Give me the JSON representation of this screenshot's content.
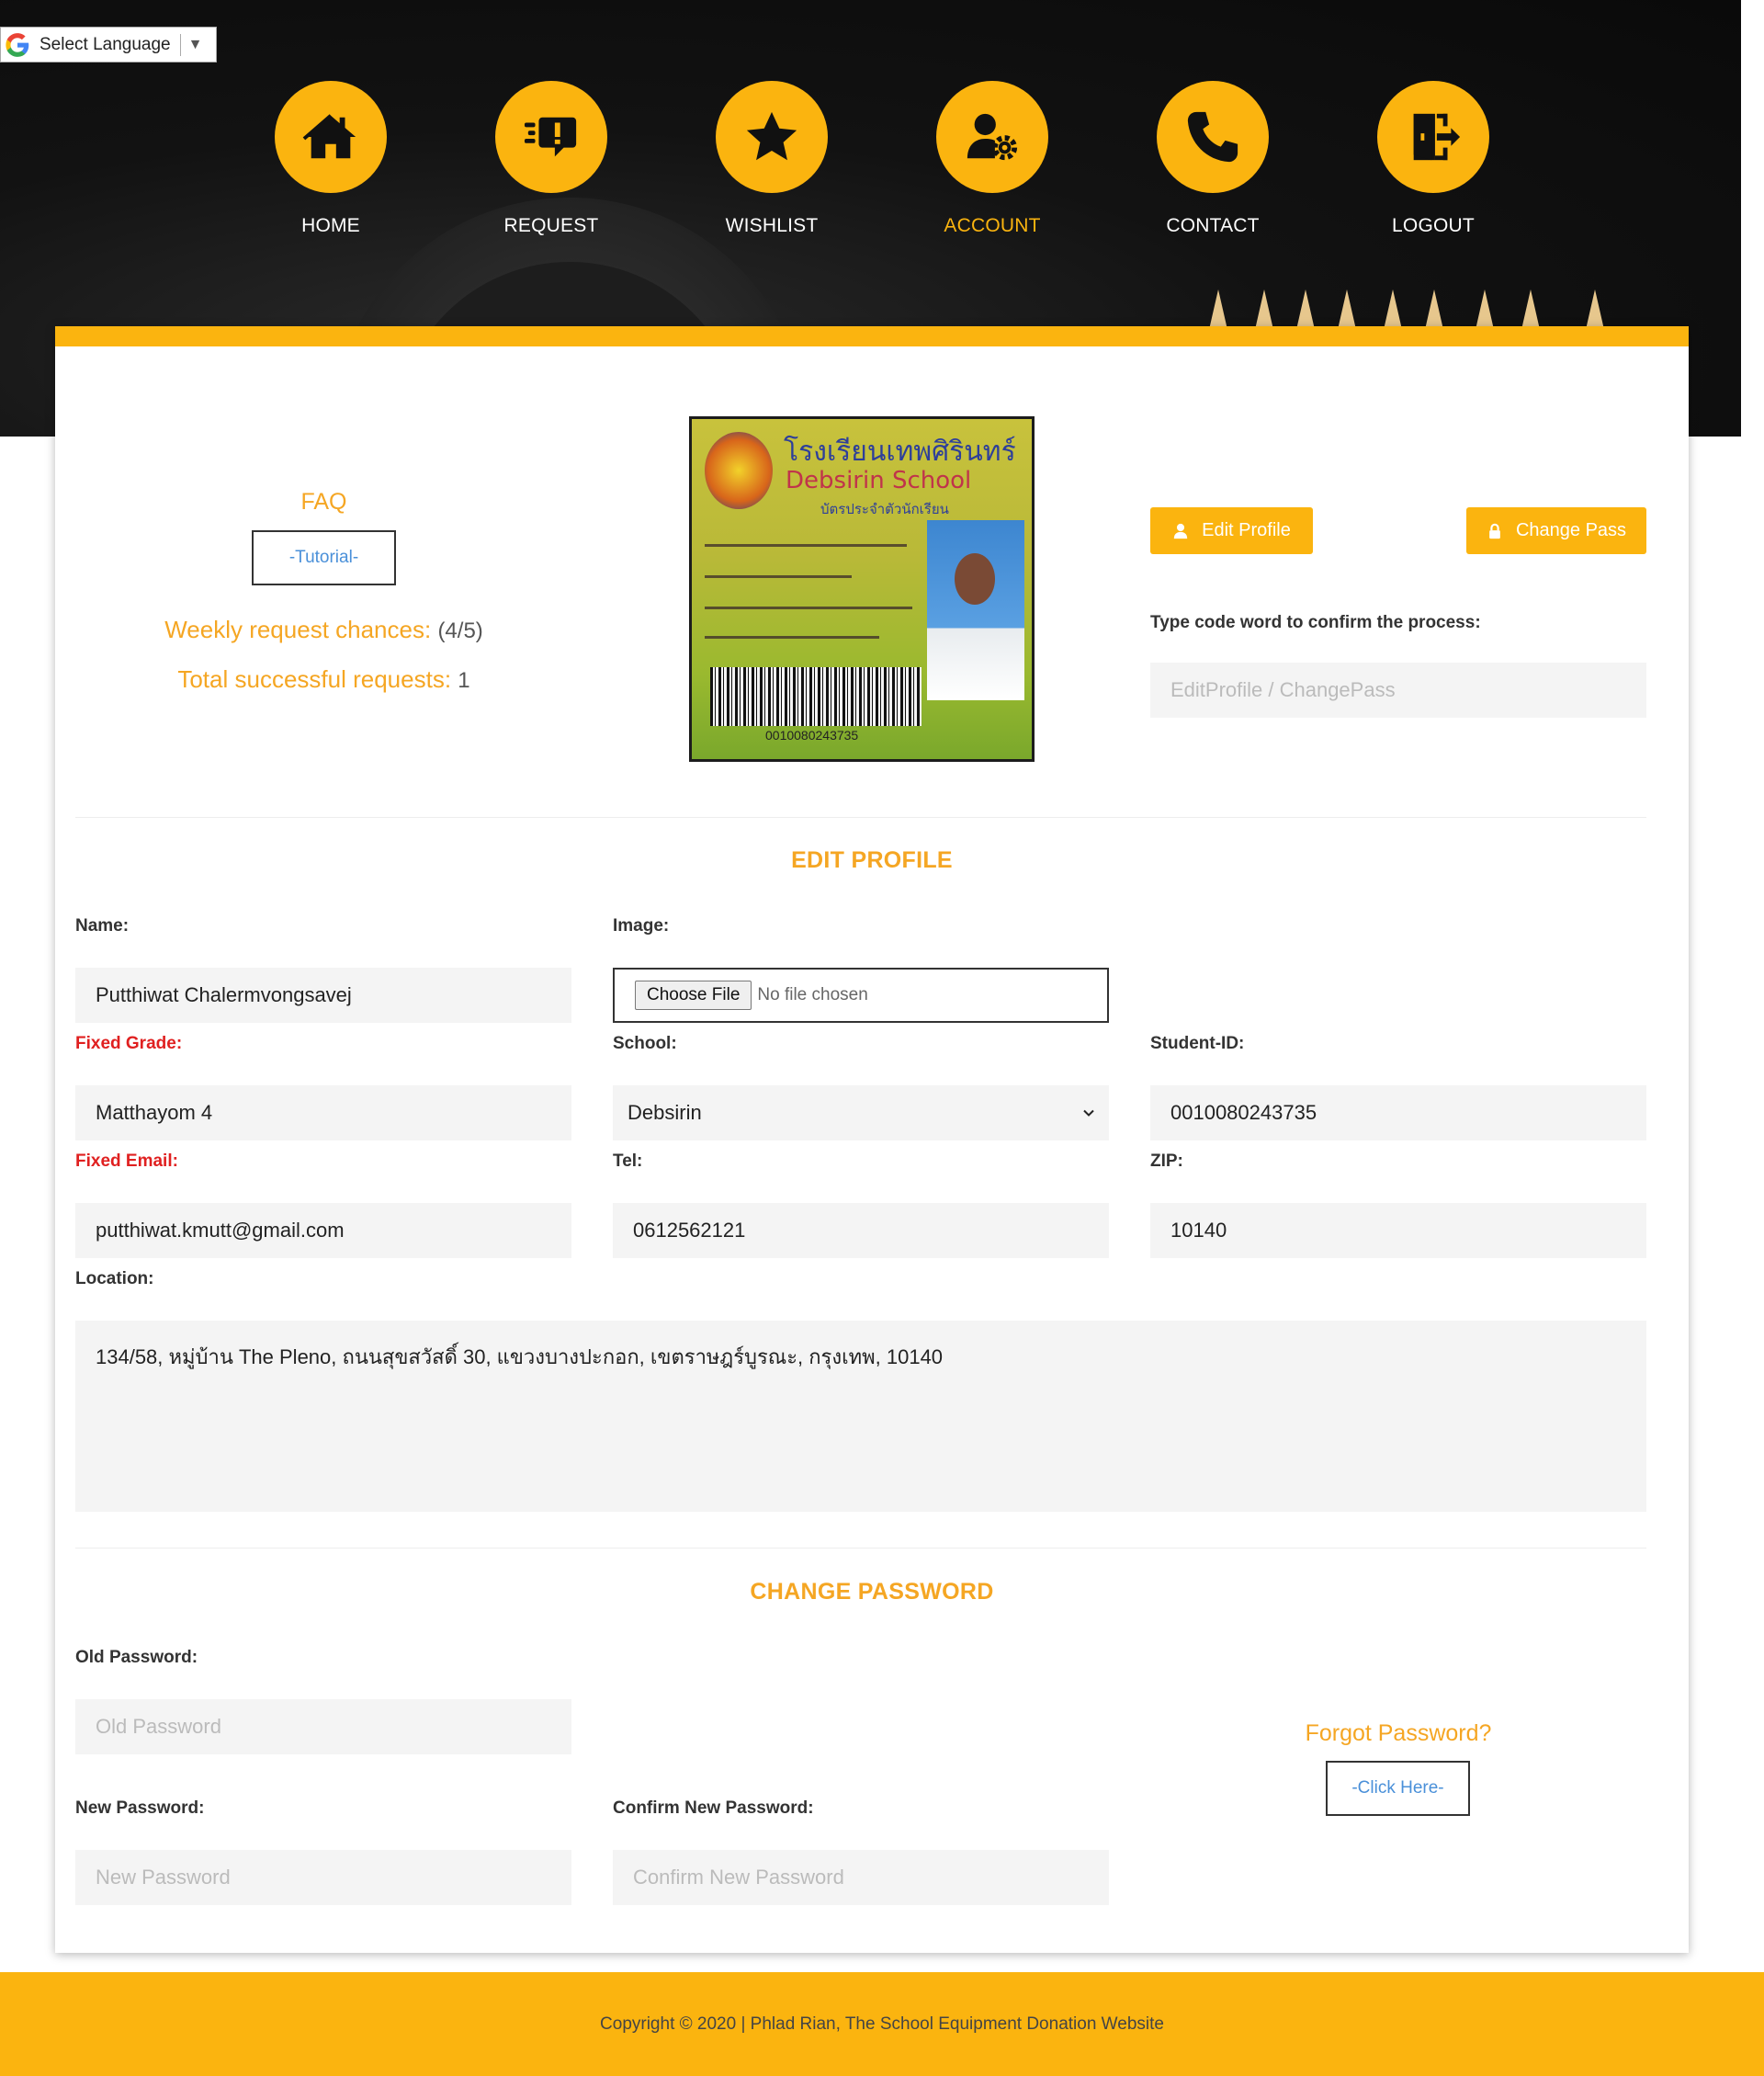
{
  "language_selector": {
    "label": "Select Language",
    "arrow": "▼",
    "icon": "google-icon"
  },
  "nav": {
    "accent": "#fbb40f",
    "items": [
      {
        "label": "HOME",
        "icon": "home-icon",
        "active": false
      },
      {
        "label": "REQUEST",
        "icon": "request-icon",
        "active": false
      },
      {
        "label": "WISHLIST",
        "icon": "star-icon",
        "active": false
      },
      {
        "label": "ACCOUNT",
        "icon": "user-gear-icon",
        "active": true
      },
      {
        "label": "CONTACT",
        "icon": "phone-icon",
        "active": false
      },
      {
        "label": "LOGOUT",
        "icon": "logout-icon",
        "active": false
      }
    ]
  },
  "summary": {
    "faq_title": "FAQ",
    "tutorial_label": "-Tutorial-",
    "weekly_label": "Weekly request chances:",
    "weekly_value": "(4/5)",
    "total_label": "Total successful requests:",
    "total_value": "1"
  },
  "id_card": {
    "school_thai": "โรงเรียนเทพศิรินทร์",
    "school_en": "Debsirin  School",
    "card_type": "บัตรประจำตัวนักเรียน",
    "barcode_number": "0010080243735"
  },
  "actions": {
    "edit_profile_label": "Edit Profile",
    "change_pass_label": "Change Pass",
    "codeword_label": "Type code word to confirm the process:",
    "codeword_placeholder": "EditProfile / ChangePass"
  },
  "edit_profile": {
    "title": "EDIT PROFILE",
    "name_label": "Name:",
    "name_value": "Putthiwat Chalermvongsavej",
    "image_label": "Image:",
    "file_button": "Choose File",
    "file_status": "No file chosen",
    "grade_label": "Fixed Grade:",
    "grade_value": "Matthayom 4",
    "school_label": "School:",
    "school_value": "Debsirin",
    "student_id_label": "Student-ID:",
    "student_id_value": "0010080243735",
    "email_label": "Fixed Email:",
    "email_value": "putthiwat.kmutt@gmail.com",
    "tel_label": "Tel:",
    "tel_value": "0612562121",
    "zip_label": "ZIP:",
    "zip_value": "10140",
    "location_label": "Location:",
    "location_value": "134/58, หมู่บ้าน The Pleno, ถนนสุขสวัสดิ์ 30, แขวงบางปะกอก, เขตราษฎร์บูรณะ, กรุงเทพ, 10140"
  },
  "change_password": {
    "title": "CHANGE PASSWORD",
    "old_label": "Old Password:",
    "old_placeholder": "Old Password",
    "new_label": "New Password:",
    "new_placeholder": "New Password",
    "confirm_label": "Confirm New Password:",
    "confirm_placeholder": "Confirm New Password",
    "forgot_title": "Forgot Password?",
    "click_here_label": "-Click Here-"
  },
  "footer": {
    "copyright": "Copyright © 2020 | Phlad Rian, The School Equipment Donation Website"
  }
}
